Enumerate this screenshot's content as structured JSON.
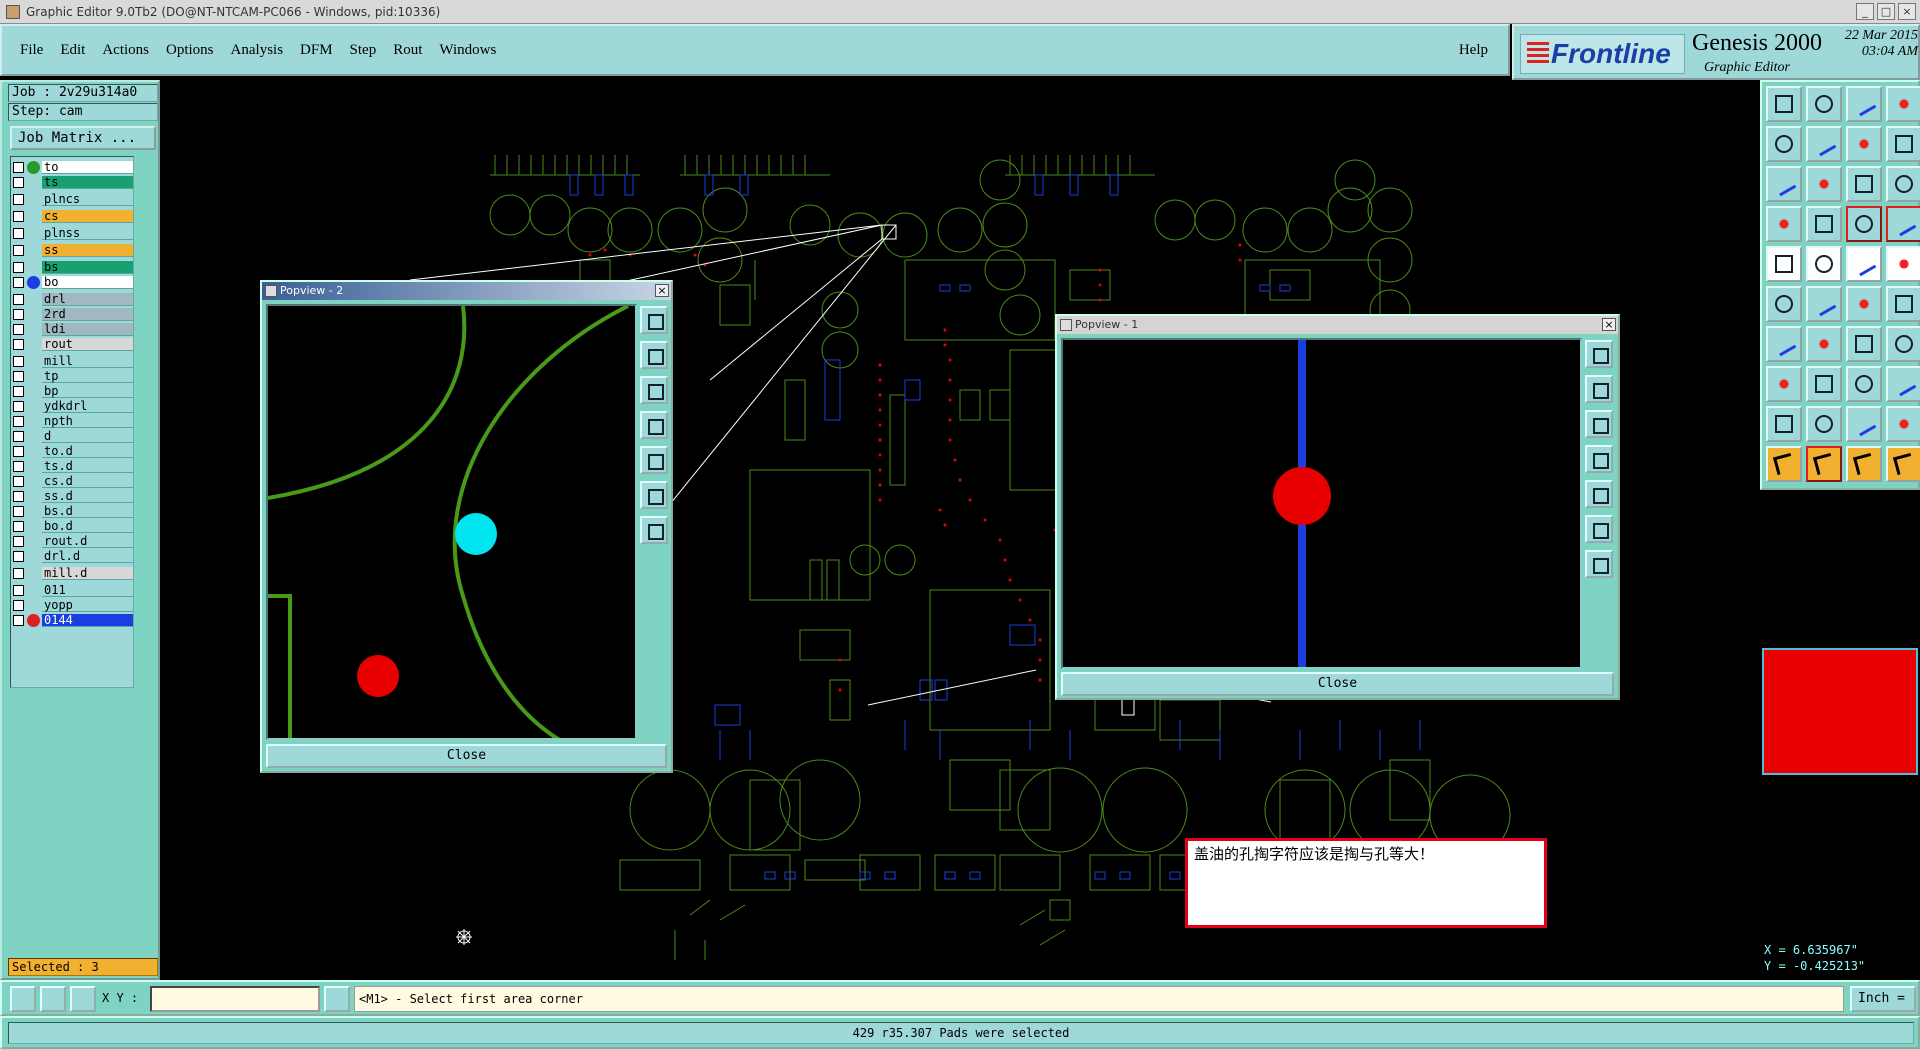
{
  "window": {
    "title": "Graphic Editor 9.0Tb2 (DO@NT-NTCAM-PC066 - Windows, pid:10336)"
  },
  "menu": {
    "items": [
      "File",
      "Edit",
      "Actions",
      "Options",
      "Analysis",
      "DFM",
      "Step",
      "Rout",
      "Windows"
    ],
    "help": "Help"
  },
  "brand": {
    "logo": "Frontline",
    "product": "Genesis 2000",
    "subtitle": "Graphic Editor",
    "date": "22 Mar 2015",
    "time": "03:04 AM"
  },
  "job": {
    "job": "Job : 2v29u314a0",
    "step": "Step: cam",
    "matrix_button": "Job Matrix ...",
    "selected": "Selected : 3"
  },
  "layers": [
    {
      "name": "to",
      "color": "#ffffff",
      "dot": "#2a9a2a"
    },
    {
      "name": "ts",
      "color": "#18a070",
      "dot": ""
    },
    {
      "name": "plncs",
      "color": "#9ed8d8",
      "dot": ""
    },
    {
      "name": "cs",
      "color": "#f2b030",
      "dot": ""
    },
    {
      "name": "plnss",
      "color": "#9ed8d8",
      "dot": ""
    },
    {
      "name": "ss",
      "color": "#f2b030",
      "dot": ""
    },
    {
      "name": "bs",
      "color": "#18a070",
      "dot": ""
    },
    {
      "name": "bo",
      "color": "#ffffff",
      "dot": "#1a3fe0"
    },
    {
      "name": "drl",
      "color": "#a0b8c0",
      "dot": ""
    },
    {
      "name": "2rd",
      "color": "#a0b8c0",
      "dot": ""
    },
    {
      "name": "ldi",
      "color": "#a0b8c0",
      "dot": ""
    },
    {
      "name": "rout",
      "color": "#d8d8d8",
      "dot": ""
    },
    {
      "name": "mill",
      "color": "#9ed8d8",
      "dot": ""
    },
    {
      "name": "tp",
      "color": "#9ed8d8",
      "dot": ""
    },
    {
      "name": "bp",
      "color": "#9ed8d8",
      "dot": ""
    },
    {
      "name": "ydkdrl",
      "color": "#9ed8d8",
      "dot": ""
    },
    {
      "name": "npth",
      "color": "#9ed8d8",
      "dot": ""
    },
    {
      "name": "d",
      "color": "#9ed8d8",
      "dot": ""
    },
    {
      "name": "to.d",
      "color": "#9ed8d8",
      "dot": ""
    },
    {
      "name": "ts.d",
      "color": "#9ed8d8",
      "dot": ""
    },
    {
      "name": "cs.d",
      "color": "#9ed8d8",
      "dot": ""
    },
    {
      "name": "ss.d",
      "color": "#9ed8d8",
      "dot": ""
    },
    {
      "name": "bs.d",
      "color": "#9ed8d8",
      "dot": ""
    },
    {
      "name": "bo.d",
      "color": "#9ed8d8",
      "dot": ""
    },
    {
      "name": "rout.d",
      "color": "#9ed8d8",
      "dot": ""
    },
    {
      "name": "drl.d",
      "color": "#9ed8d8",
      "dot": ""
    },
    {
      "name": "mill.d",
      "color": "#d8d8d8",
      "dot": ""
    },
    {
      "name": "011",
      "color": "#9ed8d8",
      "dot": ""
    },
    {
      "name": "yopp",
      "color": "#9ed8d8",
      "dot": ""
    },
    {
      "name": "0144",
      "color": "#1a3fe0",
      "dot": "#e02020"
    }
  ],
  "popview2": {
    "title": "Popview - 2",
    "close": "Close"
  },
  "popview1": {
    "title": "Popview - 1",
    "close": "Close"
  },
  "note": {
    "text": "盖油的孔掏字符应该是掏与孔等大！"
  },
  "coords": {
    "x": "X = 6.635967\"",
    "y": "Y = -0.425213\""
  },
  "bottom": {
    "xy_label": "X Y :",
    "xy_value": "",
    "prompt": "<M1> - Select first area corner",
    "unit": "Inch"
  },
  "status": {
    "text": "429 r35.307 Pads were selected"
  },
  "colors": {
    "panel": "#7fd3c3",
    "field": "#9ed8d8",
    "pcb_green": "#4a8a1a",
    "pcb_blue": "#1a3fe0",
    "pad_red": "#e80000",
    "highlight_cyan": "#00e5f0"
  }
}
